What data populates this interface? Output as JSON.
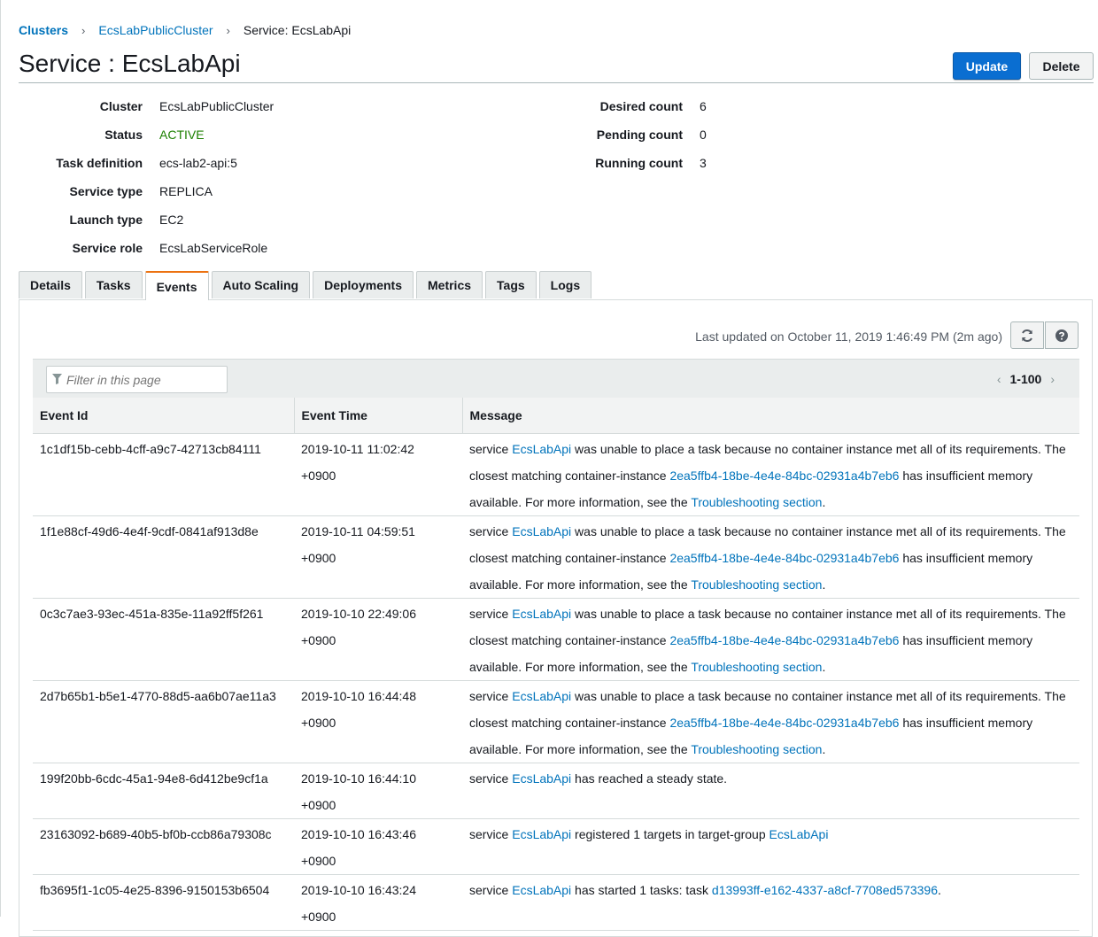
{
  "breadcrumb": {
    "root": "Clusters",
    "cluster": "EcsLabPublicCluster",
    "current": "Service: EcsLabApi",
    "separator": "›"
  },
  "page": {
    "title": "Service : EcsLabApi",
    "update_label": "Update",
    "delete_label": "Delete"
  },
  "summary": {
    "left": [
      {
        "label": "Cluster",
        "value": "EcsLabPublicCluster",
        "link": true
      },
      {
        "label": "Status",
        "value": "ACTIVE",
        "status": true
      },
      {
        "label": "Task definition",
        "value": "ecs-lab2-api:5",
        "link": true
      },
      {
        "label": "Service type",
        "value": "REPLICA"
      },
      {
        "label": "Launch type",
        "value": "EC2"
      },
      {
        "label": "Service role",
        "value": "EcsLabServiceRole"
      }
    ],
    "right": [
      {
        "label": "Desired count",
        "value": "6"
      },
      {
        "label": "Pending count",
        "value": "0"
      },
      {
        "label": "Running count",
        "value": "3"
      }
    ]
  },
  "tabs": [
    {
      "label": "Details",
      "active": false
    },
    {
      "label": "Tasks",
      "active": false
    },
    {
      "label": "Events",
      "active": true
    },
    {
      "label": "Auto Scaling",
      "active": false
    },
    {
      "label": "Deployments",
      "active": false
    },
    {
      "label": "Metrics",
      "active": false
    },
    {
      "label": "Tags",
      "active": false
    },
    {
      "label": "Logs",
      "active": false
    }
  ],
  "events_panel": {
    "last_updated": "Last updated on October 11, 2019 1:46:49 PM (2m ago)",
    "refresh_icon": "refresh-icon",
    "help_icon": "help-icon",
    "filter_placeholder": "Filter in this page",
    "filter_icon": "filter-icon",
    "page_range": "1-100",
    "columns": [
      "Event Id",
      "Event Time",
      "Message"
    ]
  },
  "events": [
    {
      "id": "1c1df15b-cebb-4cff-a9c7-42713cb84111",
      "time": "2019-10-11 11:02:42",
      "tz": "+0900",
      "message": [
        {
          "t": "service "
        },
        {
          "t": "EcsLabApi",
          "link": true
        },
        {
          "t": " was unable to place a task because no container instance met all of its requirements. The closest matching container-instance "
        },
        {
          "t": "2ea5ffb4-18be-4e4e-84bc-02931a4b7eb6",
          "link": true
        },
        {
          "t": " has insufficient memory available. For more information, see the "
        },
        {
          "t": "Troubleshooting section",
          "link": true
        },
        {
          "t": "."
        }
      ]
    },
    {
      "id": "1f1e88cf-49d6-4e4f-9cdf-0841af913d8e",
      "time": "2019-10-11 04:59:51",
      "tz": "+0900",
      "message": [
        {
          "t": "service "
        },
        {
          "t": "EcsLabApi",
          "link": true
        },
        {
          "t": " was unable to place a task because no container instance met all of its requirements. The closest matching container-instance "
        },
        {
          "t": "2ea5ffb4-18be-4e4e-84bc-02931a4b7eb6",
          "link": true
        },
        {
          "t": " has insufficient memory available. For more information, see the "
        },
        {
          "t": "Troubleshooting section",
          "link": true
        },
        {
          "t": "."
        }
      ]
    },
    {
      "id": "0c3c7ae3-93ec-451a-835e-11a92ff5f261",
      "time": "2019-10-10 22:49:06",
      "tz": "+0900",
      "message": [
        {
          "t": "service "
        },
        {
          "t": "EcsLabApi",
          "link": true
        },
        {
          "t": " was unable to place a task because no container instance met all of its requirements. The closest matching container-instance "
        },
        {
          "t": "2ea5ffb4-18be-4e4e-84bc-02931a4b7eb6",
          "link": true
        },
        {
          "t": " has insufficient memory available. For more information, see the "
        },
        {
          "t": "Troubleshooting section",
          "link": true
        },
        {
          "t": "."
        }
      ]
    },
    {
      "id": "2d7b65b1-b5e1-4770-88d5-aa6b07ae11a3",
      "time": "2019-10-10 16:44:48",
      "tz": "+0900",
      "message": [
        {
          "t": "service "
        },
        {
          "t": "EcsLabApi",
          "link": true
        },
        {
          "t": " was unable to place a task because no container instance met all of its requirements. The closest matching container-instance "
        },
        {
          "t": "2ea5ffb4-18be-4e4e-84bc-02931a4b7eb6",
          "link": true
        },
        {
          "t": " has insufficient memory available. For more information, see the "
        },
        {
          "t": "Troubleshooting section",
          "link": true
        },
        {
          "t": "."
        }
      ]
    },
    {
      "id": "199f20bb-6cdc-45a1-94e8-6d412be9cf1a",
      "time": "2019-10-10 16:44:10",
      "tz": "+0900",
      "message": [
        {
          "t": "service "
        },
        {
          "t": "EcsLabApi",
          "link": true
        },
        {
          "t": " has reached a steady state."
        }
      ]
    },
    {
      "id": "23163092-b689-40b5-bf0b-ccb86a79308c",
      "time": "2019-10-10 16:43:46",
      "tz": "+0900",
      "message": [
        {
          "t": "service "
        },
        {
          "t": "EcsLabApi",
          "link": true
        },
        {
          "t": " registered 1 targets in target-group "
        },
        {
          "t": "EcsLabApi",
          "link": true
        }
      ]
    },
    {
      "id": "fb3695f1-1c05-4e25-8396-9150153b6504",
      "time": "2019-10-10 16:43:24",
      "tz": "+0900",
      "message": [
        {
          "t": "service "
        },
        {
          "t": "EcsLabApi",
          "link": true
        },
        {
          "t": " has started 1 tasks: task "
        },
        {
          "t": "d13993ff-e162-4337-a8cf-7708ed573396",
          "link": true
        },
        {
          "t": "."
        }
      ]
    }
  ],
  "colors": {
    "link": "#0073bb",
    "status_active": "#1d8102",
    "tab_active_accent": "#ec7211",
    "primary_button": "#0a6ed1"
  }
}
